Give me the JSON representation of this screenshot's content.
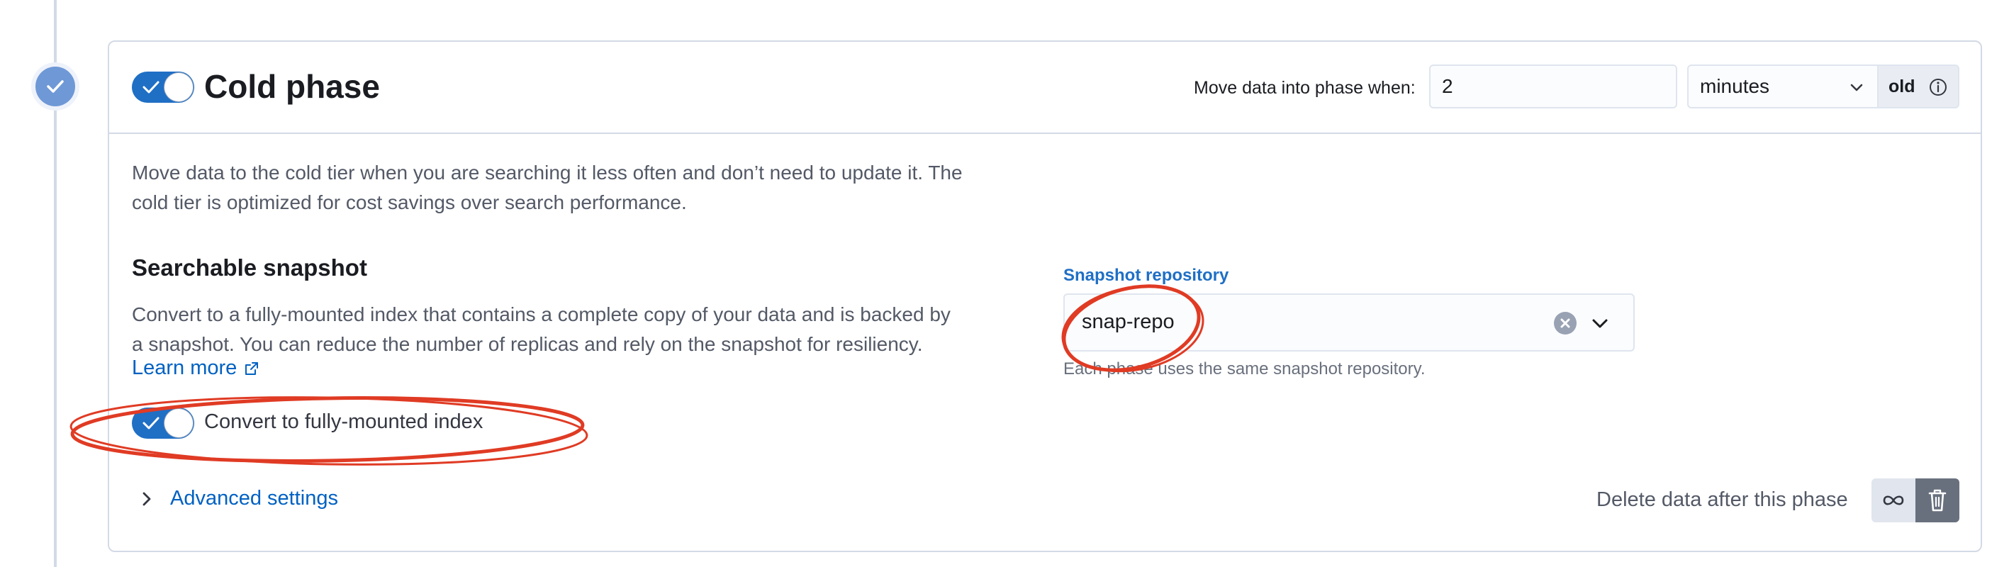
{
  "phase": {
    "title": "Cold phase",
    "enabled": true
  },
  "timing": {
    "label": "Move data into phase when:",
    "value": "2",
    "unit": "minutes",
    "suffix": "old"
  },
  "description": {
    "line1": "Move data to the cold tier when you are searching it less often and don’t need to update it. The",
    "line2": "cold tier is optimized for cost savings over search performance."
  },
  "searchable_snapshot": {
    "title": "Searchable snapshot",
    "desc_line1": "Convert to a fully-mounted index that contains a complete copy of your data and is backed by",
    "desc_line2": "a snapshot. You can reduce the number of replicas and rely on the snapshot for resiliency.",
    "learn_more": "Learn more",
    "convert_label": "Convert to fully-mounted index",
    "convert_enabled": true
  },
  "repository": {
    "label": "Snapshot repository",
    "value": "snap-repo",
    "help": "Each phase uses the same snapshot repository."
  },
  "advanced": {
    "label": "Advanced settings"
  },
  "delete": {
    "label": "Delete data after this phase"
  },
  "colors": {
    "primary": "#1f6fc5",
    "link": "#0061c2",
    "annotation": "#e03b24"
  }
}
